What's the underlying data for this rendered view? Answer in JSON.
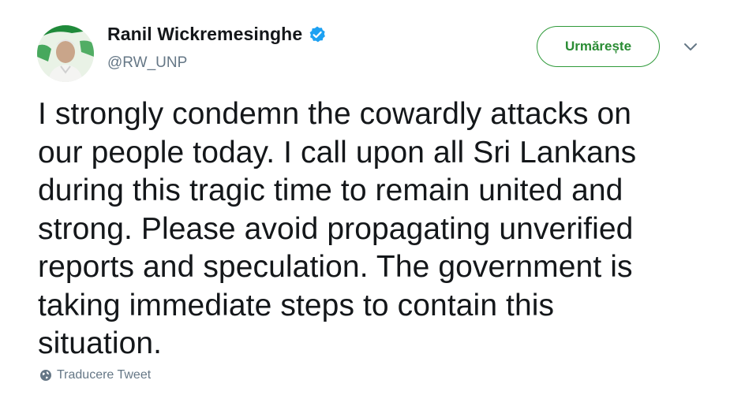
{
  "header": {
    "display_name": "Ranil Wickremesinghe",
    "handle": "@RW_UNP",
    "verified": true,
    "follow_label": "Urmărește"
  },
  "tweet": {
    "text": "I strongly condemn the cowardly attacks on\nour people today. I call upon all Sri Lankans\nduring this tragic time to remain united and\nstrong. Please avoid propagating unverified\nreports and speculation. The government is\ntaking immediate steps to contain this\nsituation.",
    "translate_label": "Traducere Tweet"
  },
  "icons": {
    "verified": "verified-badge-icon",
    "caret": "chevron-down-icon",
    "translate": "globe-icon"
  },
  "colors": {
    "follow_accent": "#2f9a3a",
    "verified_blue": "#1da1f2",
    "secondary_text": "#657786"
  }
}
